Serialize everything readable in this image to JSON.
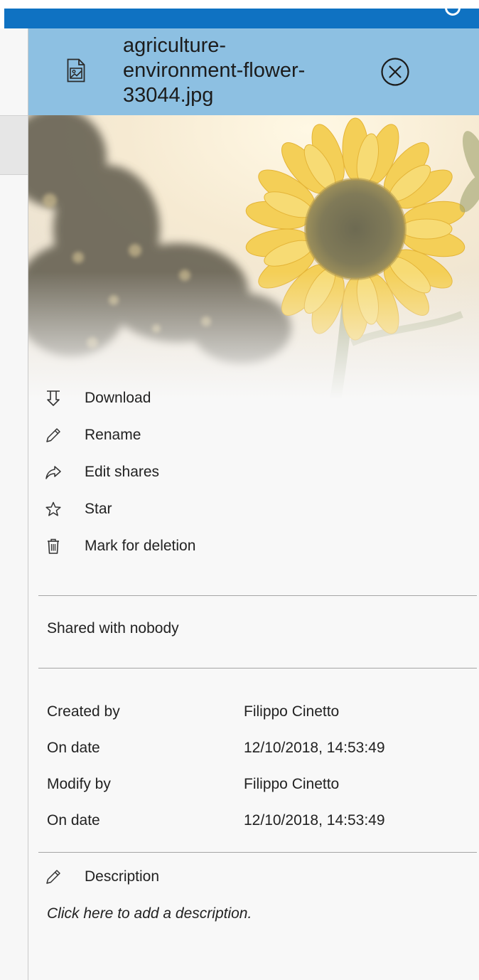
{
  "header": {
    "title_lines": [
      "agriculture-",
      "environment-flower-",
      "33044.jpg"
    ],
    "file_icon": "image-file-icon",
    "close_icon": "close-circle-icon",
    "accent": "#8dc0e2",
    "topbar_color": "#0f72c2"
  },
  "preview": {
    "icon": "sunflower-photo"
  },
  "actions": [
    {
      "label": "Download",
      "icon": "download-icon"
    },
    {
      "label": "Rename",
      "icon": "pencil-icon"
    },
    {
      "label": "Edit shares",
      "icon": "share-icon"
    },
    {
      "label": "Star",
      "icon": "star-icon"
    },
    {
      "label": "Mark for deletion",
      "icon": "trash-icon"
    }
  ],
  "sharing": {
    "status": "Shared with nobody"
  },
  "meta": [
    {
      "key": "Created by",
      "value": "Filippo Cinetto"
    },
    {
      "key": "On date",
      "value": "12/10/2018, 14:53:49"
    },
    {
      "key": "Modify by",
      "value": "Filippo Cinetto"
    },
    {
      "key": "On date",
      "value": "12/10/2018, 14:53:49"
    }
  ],
  "description": {
    "label": "Description",
    "placeholder": "Click here to add a description."
  }
}
